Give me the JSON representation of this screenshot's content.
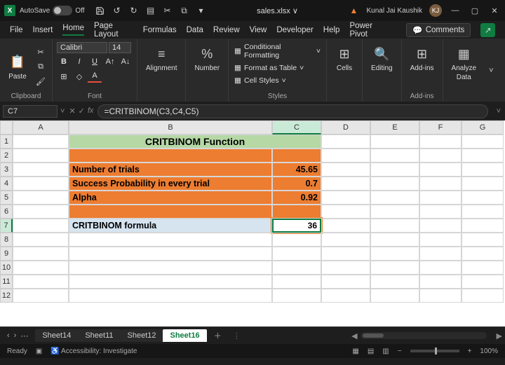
{
  "titlebar": {
    "autosave_label": "AutoSave",
    "autosave_state": "Off",
    "doc_name": "sales.xlsx ∨",
    "user_name": "Kunal Jai Kaushik",
    "user_initials": "KJ"
  },
  "menu": {
    "file": "File",
    "insert": "Insert",
    "home": "Home",
    "page_layout": "Page Layout",
    "formulas": "Formulas",
    "data": "Data",
    "review": "Review",
    "view": "View",
    "developer": "Developer",
    "help": "Help",
    "power_pivot": "Power Pivot",
    "comments": "Comments"
  },
  "ribbon": {
    "paste": "Paste",
    "clipboard_label": "Clipboard",
    "font_name": "Calibri",
    "font_size": "14",
    "font_label": "Font",
    "alignment": "Alignment",
    "number": "Number",
    "cond_fmt": "Conditional Formatting",
    "fmt_table": "Format as Table",
    "cell_styles": "Cell Styles",
    "styles_label": "Styles",
    "cells": "Cells",
    "editing": "Editing",
    "addins": "Add-ins",
    "addins_label": "Add-ins",
    "analyze": "Analyze",
    "analyze2": "Data"
  },
  "formula": {
    "cell_ref": "C7",
    "formula_text": "=CRITBINOM(C3,C4,C5)"
  },
  "headers": {
    "A": "A",
    "B": "B",
    "C": "C",
    "D": "D",
    "E": "E",
    "F": "F",
    "G": "G"
  },
  "rows": [
    "1",
    "2",
    "3",
    "4",
    "5",
    "6",
    "7",
    "8",
    "9",
    "10",
    "11",
    "12"
  ],
  "cells": {
    "title": "CRITBINOM Function",
    "b3": "Number of trials",
    "c3": "45.65",
    "b4": "Success Probability in every trial",
    "c4": "0.7",
    "b5": "Alpha",
    "c5": "0.92",
    "b7": "CRITBINOM formula",
    "c7": "36"
  },
  "tabs": {
    "s14": "Sheet14",
    "s11": "Sheet11",
    "s12": "Sheet12",
    "s16": "Sheet16"
  },
  "status": {
    "ready": "Ready",
    "accessibility": "Accessibility: Investigate",
    "zoom": "100%"
  }
}
